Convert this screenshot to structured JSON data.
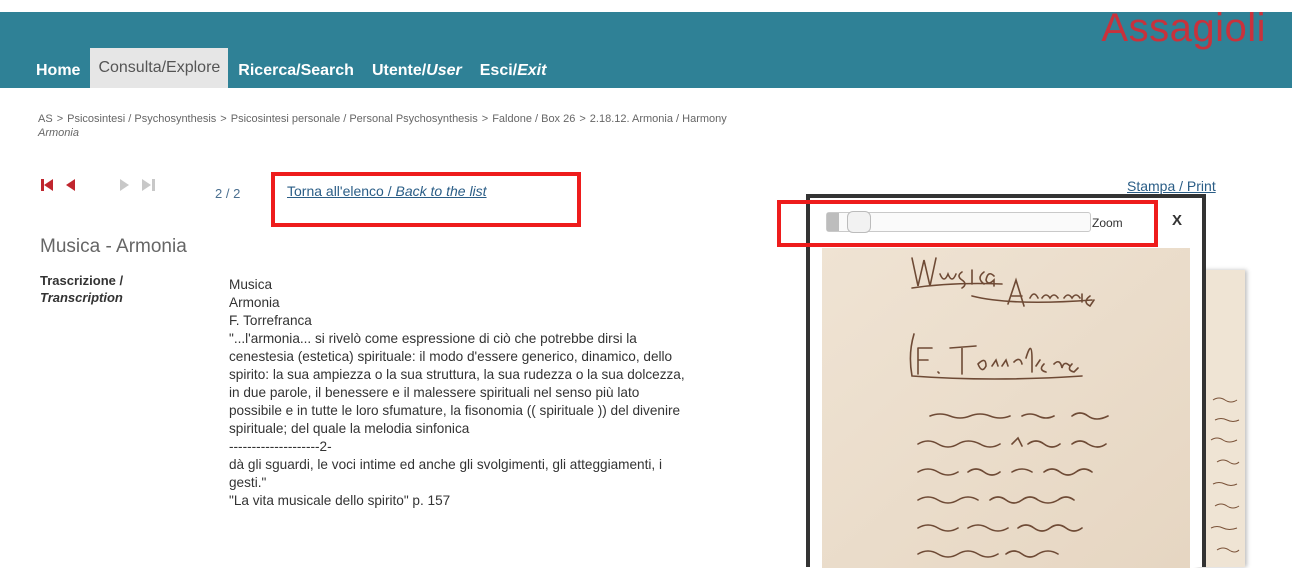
{
  "brand": "Assagioli",
  "nav": [
    {
      "label": "Home"
    },
    {
      "label": "Consulta/Explore"
    },
    {
      "label": "Ricerca/Search"
    },
    {
      "label_main": "Utente/",
      "label_em": "User"
    },
    {
      "label_main": "Esci/",
      "label_em": "Exit"
    }
  ],
  "breadcrumb": {
    "items": [
      "AS",
      "Psicosintesi / Psychosynthesis",
      "Psicosintesi personale / Personal Psychosynthesis",
      "Faldone / Box 26",
      "2.18.12. Armonia / Harmony"
    ],
    "separator": ">",
    "current": "Armonia"
  },
  "pager": {
    "icons": [
      "first-page-icon",
      "prev-page-icon",
      "next-page-icon",
      "last-page-icon"
    ],
    "count": "2 / 2",
    "back_main": "Torna all'elenco / ",
    "back_em": "Back to the list"
  },
  "print_link": "Stampa / Print",
  "document": {
    "title": "Musica - Armonia",
    "label_main": "Trascrizione /",
    "label_em": "Transcription",
    "lines": [
      "Musica",
      "Armonia",
      "F. Torrefranca",
      "\"...l'armonia... si rivelò come espressione di ciò che potrebbe dirsi la",
      "cenestesia (estetica) spirituale: il modo d'essere generico, dinamico, dello",
      "spirito: la sua ampiezza o la sua struttura, la sua rudezza o la sua dolcezza,",
      "in due parole, il benessere e il malessere spirituali nel senso più lato",
      "possibile e in tutte le loro sfumature, la fisonomia (( spirituale )) del divenire",
      "spirituale; del quale la melodia sinfonica",
      "--------------------2-",
      "dà gli sguardi, le voci intime ed anche gli svolgimenti, gli atteggiamenti, i",
      "gesti.\"",
      "\"La vita musicale dello spirito\" p. 157"
    ]
  },
  "viewer": {
    "zoom_label": "Zoom",
    "zoom_level": 0.05,
    "close_label": "X"
  },
  "colors": {
    "header": "#2f8196",
    "brand": "#c8323c",
    "highlight": "#ee1c1c",
    "pager_icon": "#c0262e"
  }
}
